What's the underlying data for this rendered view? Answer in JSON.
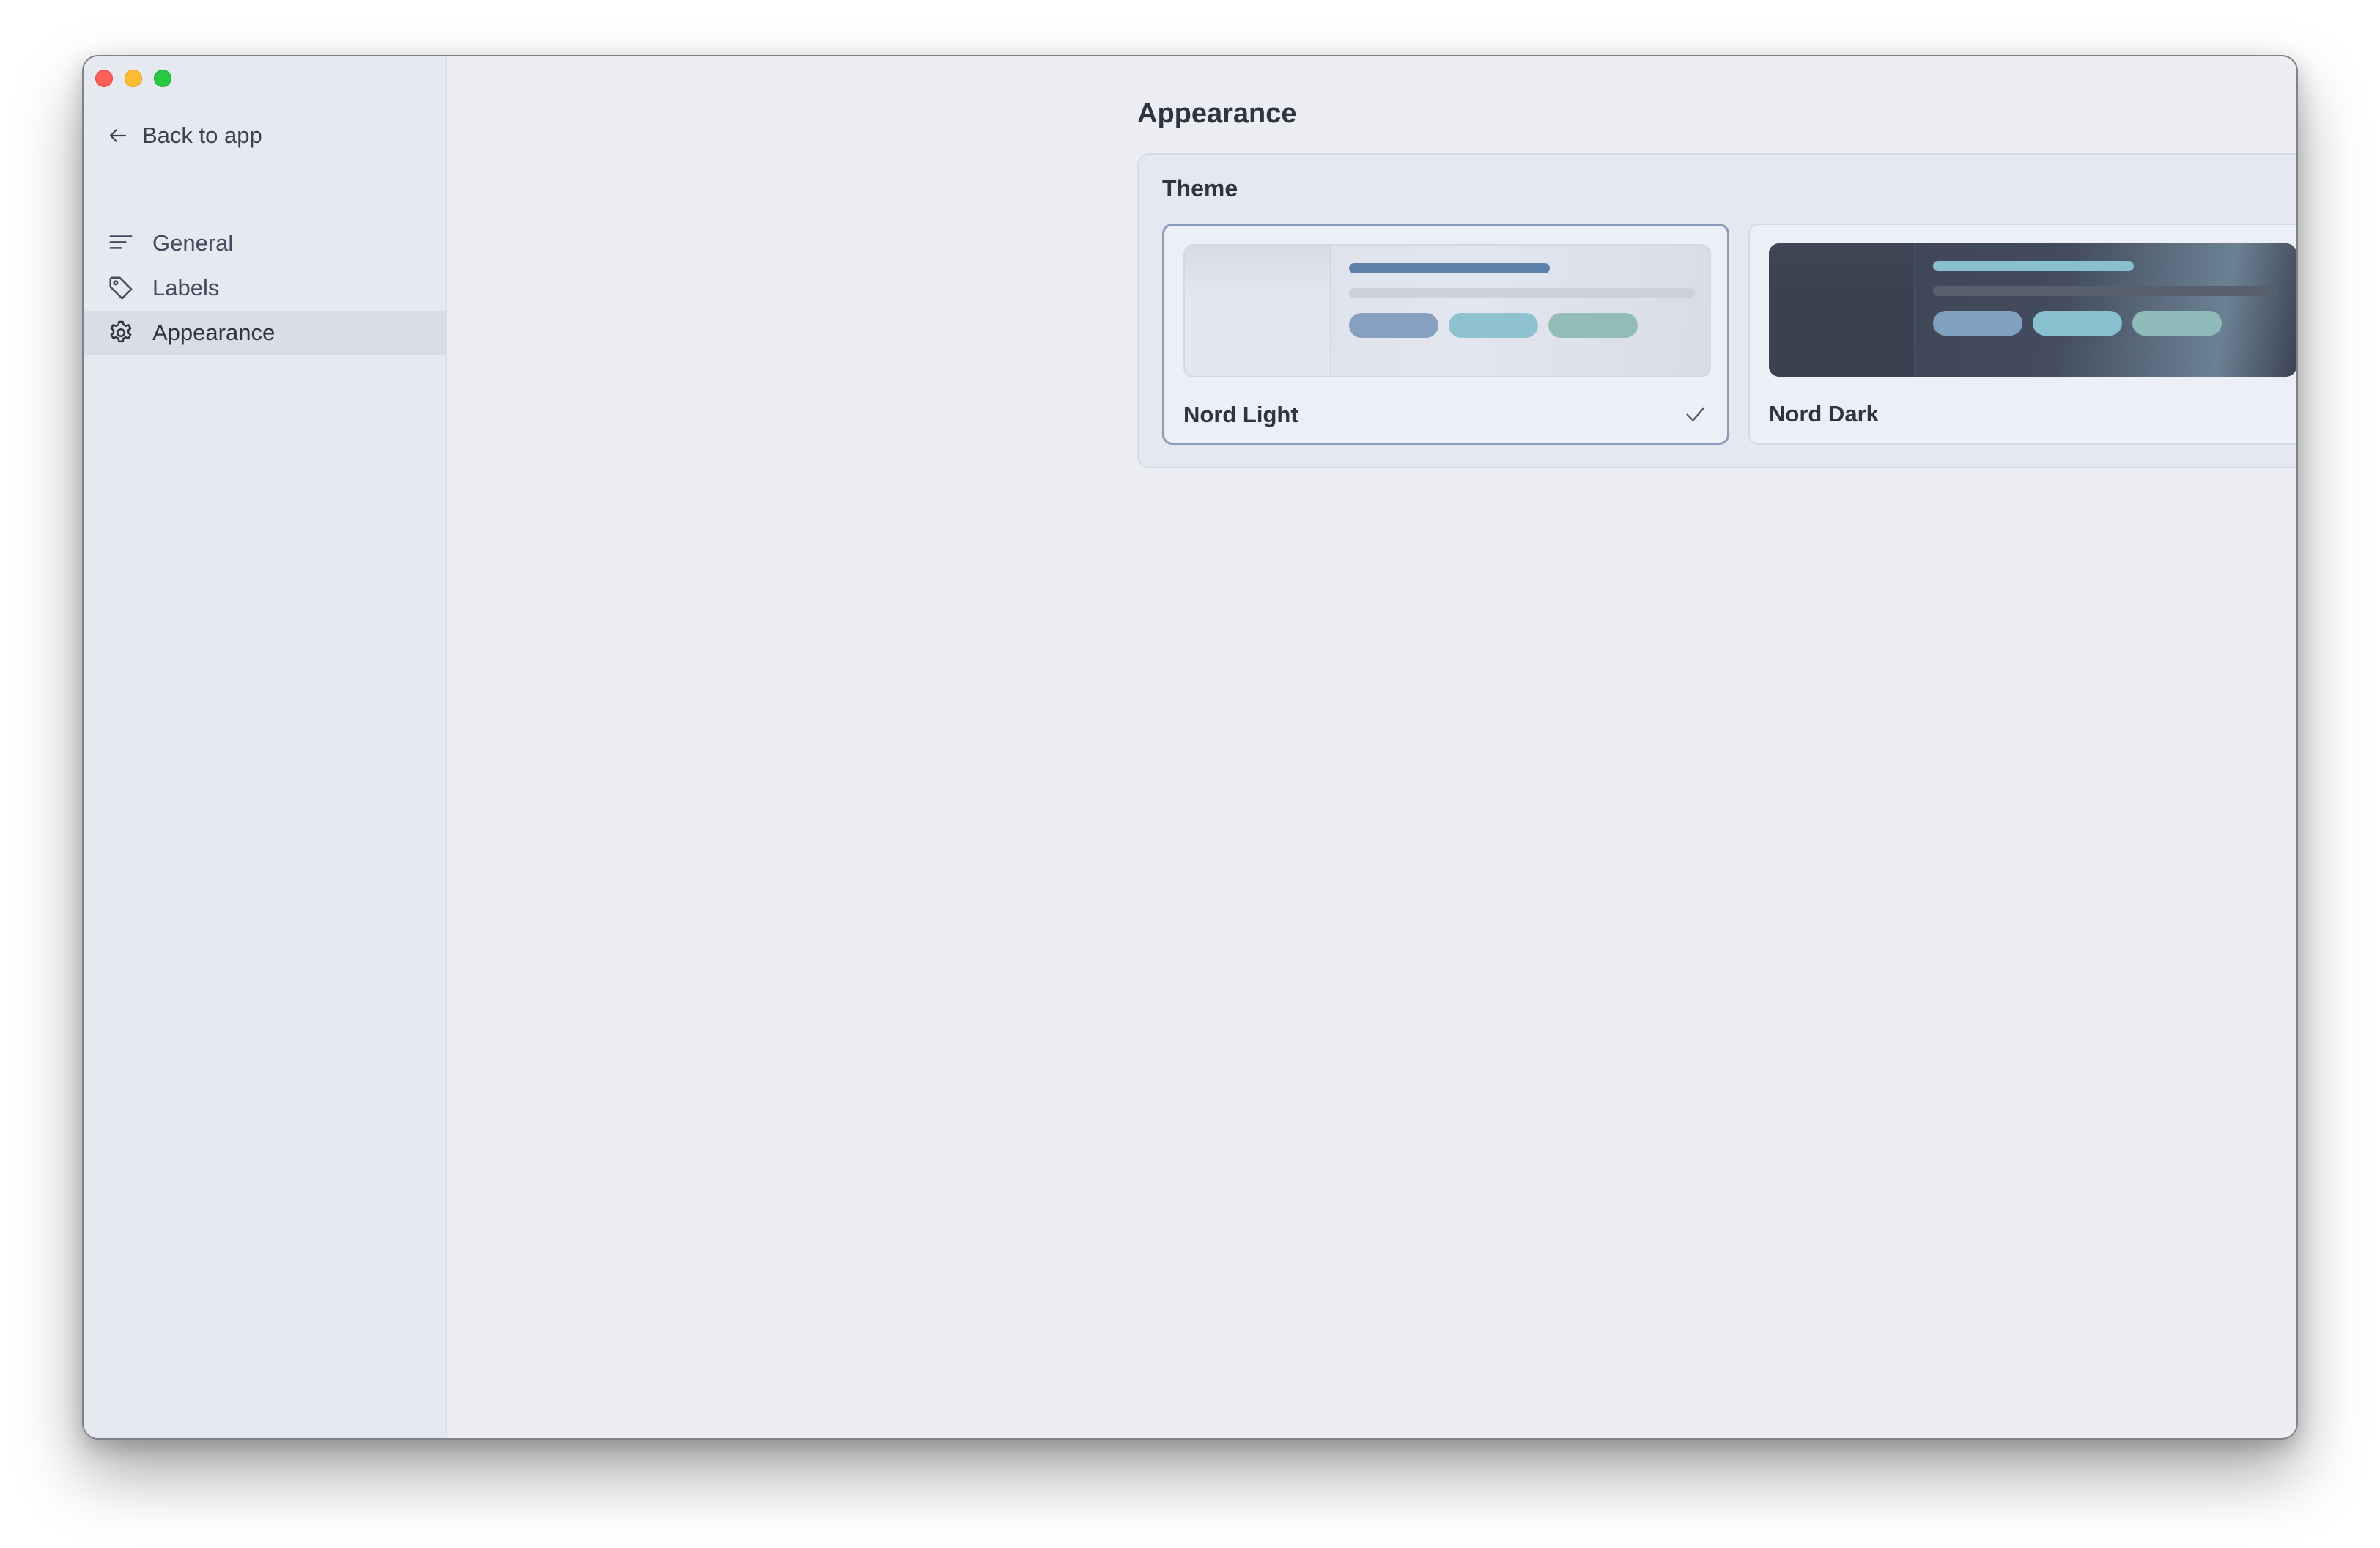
{
  "window": {
    "traffic_lights": [
      "close",
      "minimize",
      "zoom"
    ]
  },
  "sidebar": {
    "back_label": "Back to app",
    "items": [
      {
        "label": "General",
        "icon": "lines-icon",
        "active": false
      },
      {
        "label": "Labels",
        "icon": "tag-icon",
        "active": false
      },
      {
        "label": "Appearance",
        "icon": "gear-icon",
        "active": true
      }
    ]
  },
  "main": {
    "title": "Appearance",
    "theme_section": {
      "title": "Theme",
      "options": [
        {
          "label": "Nord Light",
          "selected": true
        },
        {
          "label": "Nord Dark",
          "selected": false
        }
      ]
    }
  },
  "colors": {
    "accent": "#5e81ac",
    "frost_1": "#81a1c1",
    "frost_2": "#88c0d0",
    "frost_3": "#8fbcbb",
    "polar_night": "#2e3440"
  }
}
